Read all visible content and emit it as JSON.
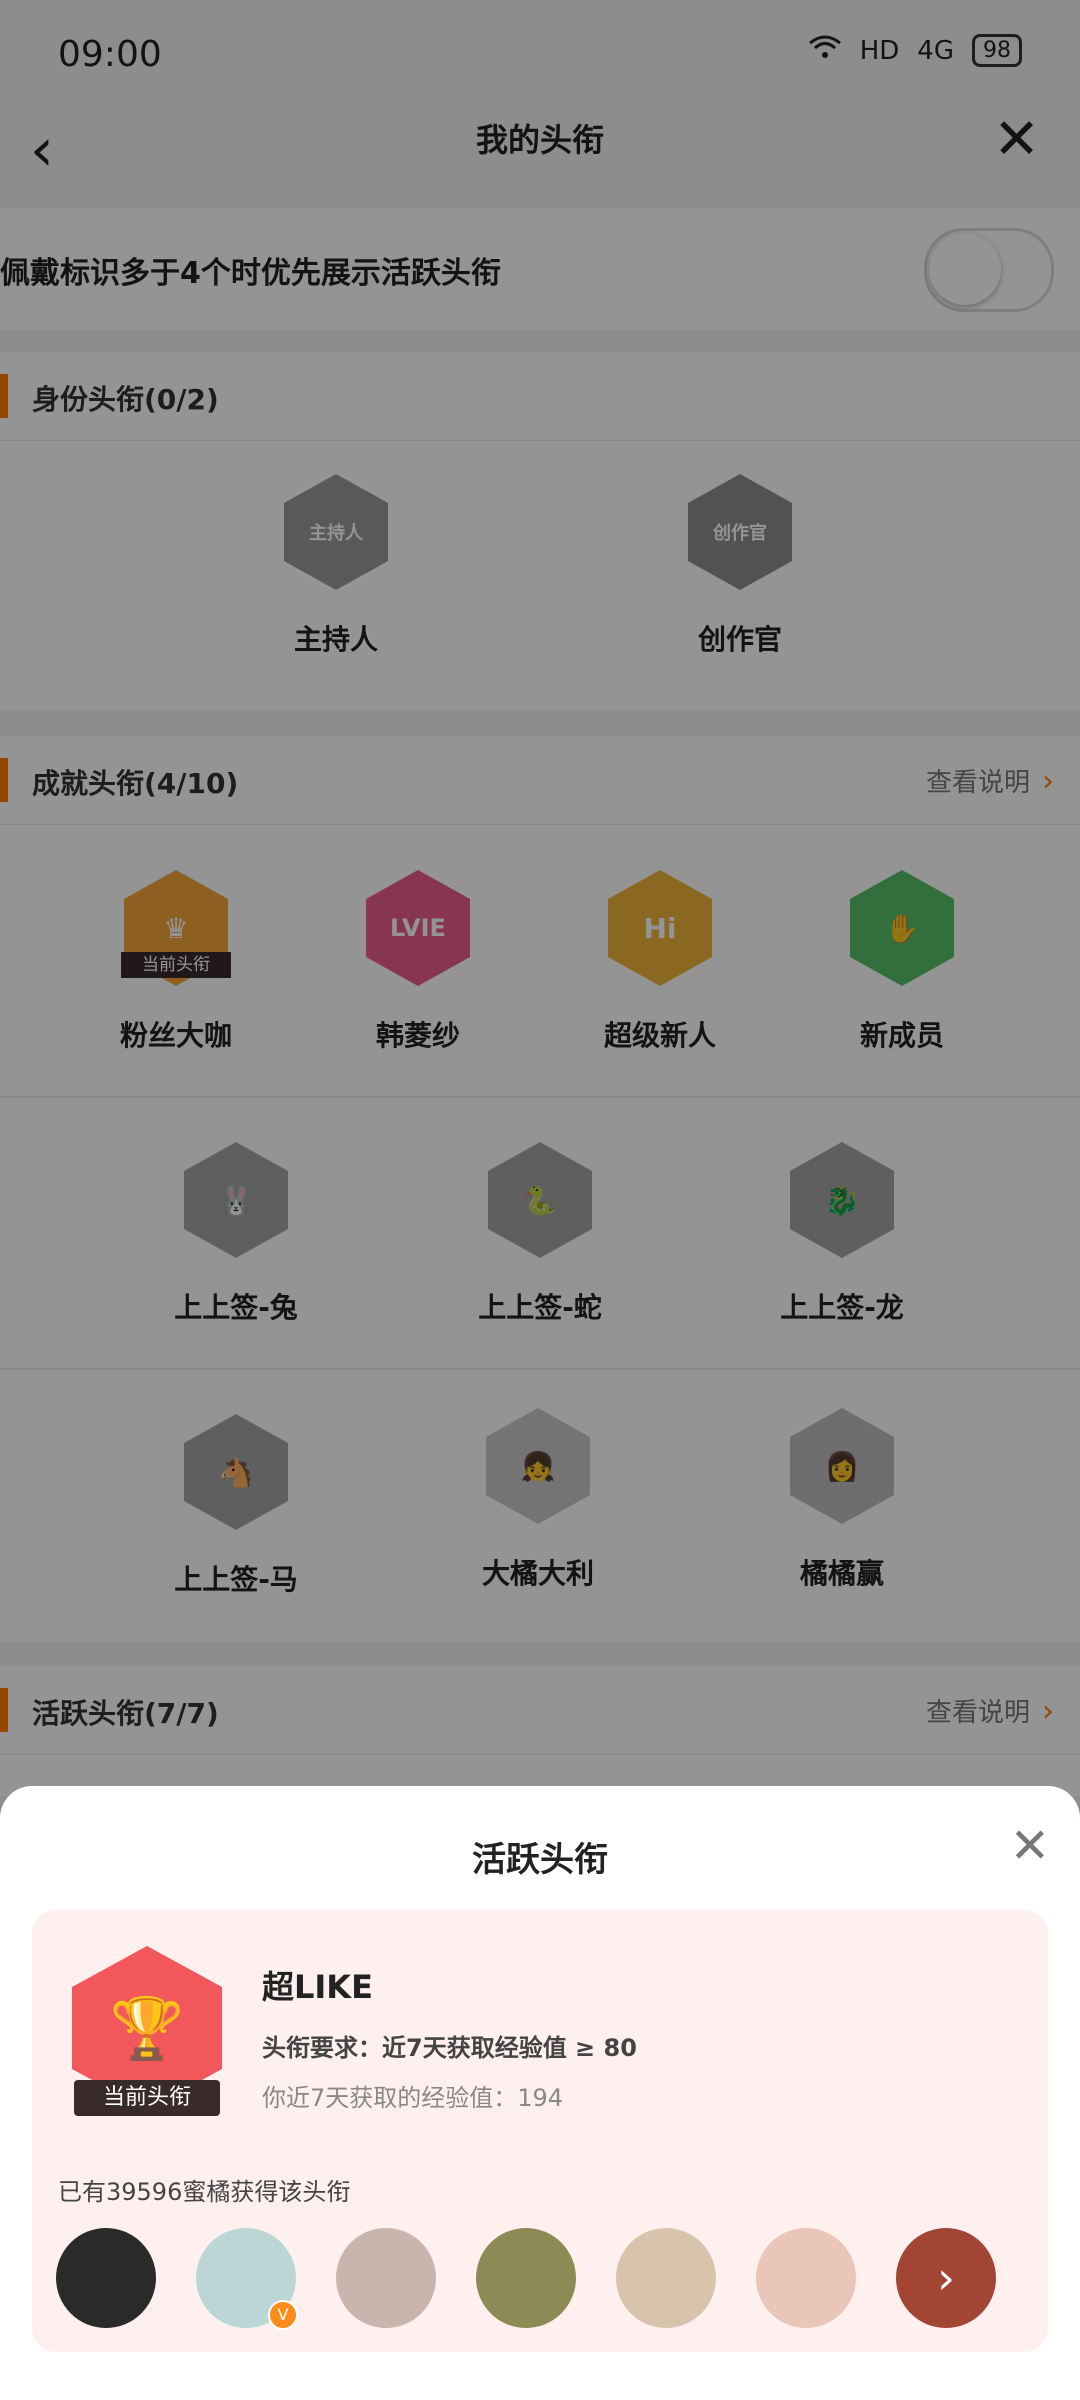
{
  "status_bar": {
    "time": "09:00",
    "network": "HD",
    "signal": "4G",
    "battery": "98"
  },
  "nav": {
    "title": "我的头衔"
  },
  "toggle_row": {
    "label": "佩戴标识多于4个时优先展示活跃头衔",
    "state": "off"
  },
  "identity_section": {
    "title": "身份头衔(0/2)",
    "badges": [
      {
        "name": "主持人",
        "icon_text": "主持人"
      },
      {
        "name": "创作官",
        "icon_text": "创作官"
      }
    ]
  },
  "achievement_section": {
    "title": "成就头衔(4/10)",
    "more_label": "查看说明",
    "row1": [
      {
        "name": "粉丝大咖",
        "tag": "当前头衔",
        "color": "#f3a63c",
        "icon": "crown-icon"
      },
      {
        "name": "韩菱纱",
        "icon_text": "LVIE",
        "color": "#ea5b8f"
      },
      {
        "name": "超级新人",
        "icon_text": "Hi",
        "color": "#f0b43a"
      },
      {
        "name": "新成员",
        "color": "#57bf6a",
        "icon": "hand-icon"
      }
    ],
    "row2": [
      {
        "name": "上上签-兔",
        "icon": "rabbit-icon"
      },
      {
        "name": "上上签-蛇",
        "icon": "snake-icon"
      },
      {
        "name": "上上签-龙",
        "icon": "dragon-icon"
      }
    ],
    "row3": [
      {
        "name": "上上签-马",
        "icon": "horse-icon"
      },
      {
        "name": "大橘大利",
        "icon": "girl-icon"
      },
      {
        "name": "橘橘赢",
        "icon": "girl-icon"
      }
    ]
  },
  "active_section": {
    "title": "活跃头衔(7/7)",
    "more_label": "查看说明"
  },
  "sheet": {
    "title": "活跃头衔",
    "badge_tag": "当前头衔",
    "badge_name": "超LIKE",
    "requirement": "头衔要求：近7天获取经验值 ≥ 80",
    "my_value": "你近7天获取的经验值：194",
    "count_text": "已有39596蜜橘获得该头衔",
    "verified_mark": "V",
    "avatars": [
      "#2a2a2a",
      "#bcd6d6",
      "#c9b4ae",
      "#8e8a55",
      "#d8c4ad",
      "#e9c6b8",
      "#a34534"
    ]
  }
}
